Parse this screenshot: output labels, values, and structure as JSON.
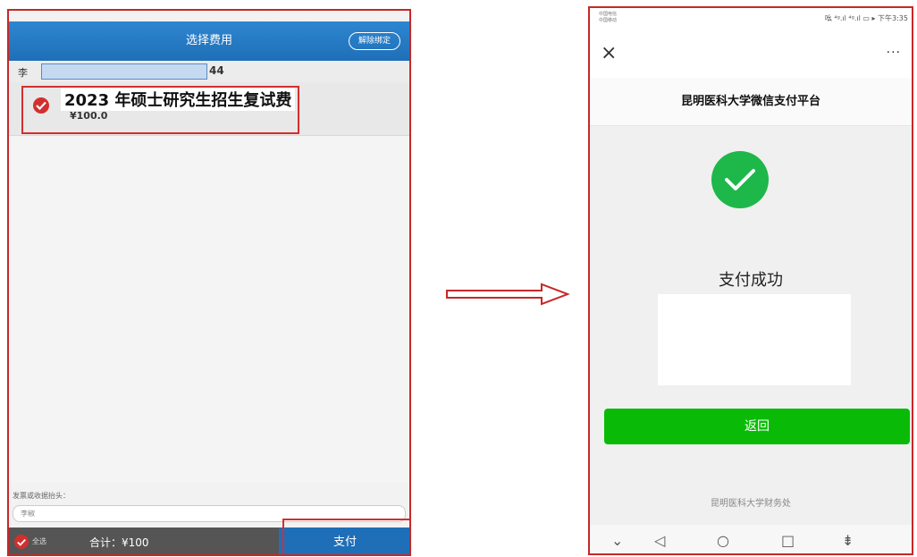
{
  "left_screen": {
    "header": {
      "title": "选择费用",
      "unbind_button": "解除绑定"
    },
    "user": {
      "name_prefix": "李",
      "id_suffix": "44"
    },
    "fee_item": {
      "name": "2023 年硕士研究生招生复试费",
      "price": "¥100.0",
      "selected": true
    },
    "invoice": {
      "label": "发票或收据抬头：",
      "value": "李椒"
    },
    "bottom_bar": {
      "select_all_label": "全选",
      "total_text": "合计：¥100",
      "pay_button": "支付"
    },
    "colors": {
      "header": "#1f6fb8",
      "highlight": "#d32f2f"
    }
  },
  "right_screen": {
    "status_bar": {
      "carrier_line1": "中国电信",
      "carrier_line2": "中国移动",
      "icons_time": "吆 ⁴ᵍ.ıl ⁴ᵍ.ıl ▭ ▸ 下午3:35"
    },
    "nav": {
      "close_icon": "×",
      "more_icon": "···"
    },
    "site_title": "昆明医科大学微信支付平台",
    "result_text": "支付成功",
    "return_button": "返回",
    "footer": "昆明医科大学财务处",
    "system_nav": [
      "⌄",
      "◁",
      "○",
      "□",
      "⇟"
    ],
    "colors": {
      "success": "#1db74a",
      "button": "#09bb07"
    }
  }
}
